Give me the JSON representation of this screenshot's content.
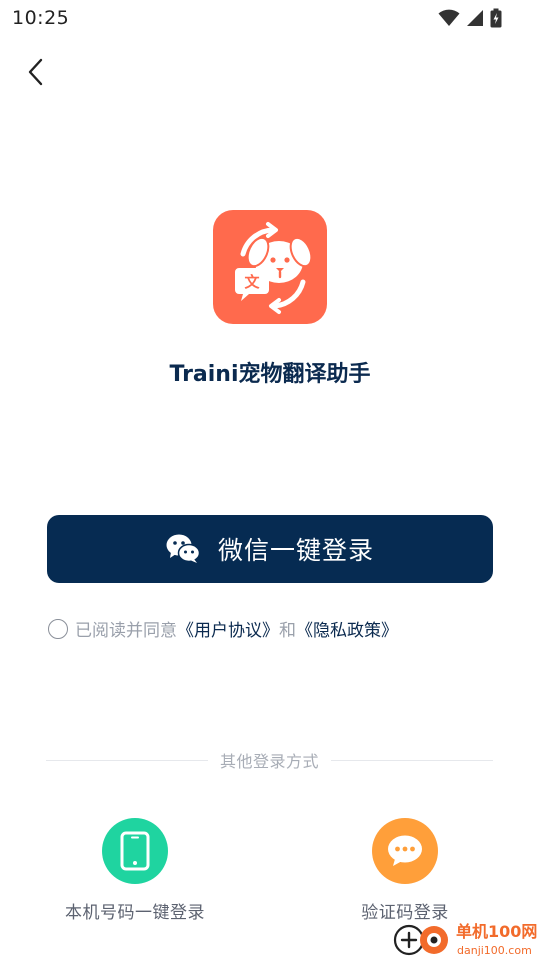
{
  "status_bar": {
    "time": "10:25"
  },
  "app": {
    "name": "Traini宠物翻译助手",
    "logo_glyph": "文",
    "brand_color": "#ff6a4d"
  },
  "wechat_login": {
    "label": "微信一键登录",
    "bg_color": "#062b52"
  },
  "agreement": {
    "prefix": "已阅读并同意",
    "user_agreement": "《用户协议》",
    "and": "和",
    "privacy_policy": "《隐私政策》"
  },
  "other_login": {
    "divider_label": "其他登录方式",
    "phone_label": "本机号码一键登录",
    "sms_label": "验证码登录"
  },
  "watermark": {
    "brand": "单机100网",
    "url": "danji100.com"
  }
}
